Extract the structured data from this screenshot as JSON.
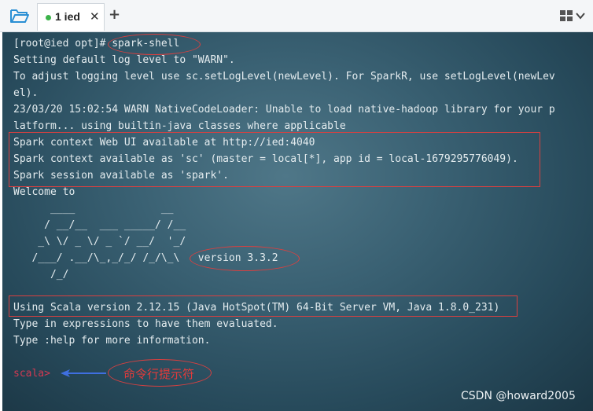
{
  "tabbar": {
    "folder_icon": "folder-open-icon",
    "tab_label": "1 ied",
    "tab_close": "✕",
    "new_tab": "+",
    "layout_icon": "grid-icon",
    "menu_icon": "chevron-down-icon"
  },
  "terminal": {
    "lines": [
      "[root@ied opt]# spark-shell",
      "Setting default log level to \"WARN\".",
      "To adjust logging level use sc.setLogLevel(newLevel). For SparkR, use setLogLevel(newLev",
      "el).",
      "23/03/20 15:02:54 WARN NativeCodeLoader: Unable to load native-hadoop library for your p",
      "latform... using builtin-java classes where applicable",
      "Spark context Web UI available at http://ied:4040",
      "Spark context available as 'sc' (master = local[*], app id = local-1679295776049).",
      "Spark session available as 'spark'.",
      "Welcome to"
    ],
    "logo": [
      "      ____              __",
      "     / __/__  ___ _____/ /__",
      "    _\\ \\/ _ \\/ _ `/ __/  '_/",
      "   /___/ .__/\\_,_/_/ /_/\\_\\   version 3.3.2",
      "      /_/"
    ],
    "after": [
      "Using Scala version 2.12.15 (Java HotSpot(TM) 64-Bit Server VM, Java 1.8.0_231)",
      "Type in expressions to have them evaluated.",
      "Type :help for more information."
    ],
    "prompt": "scala>"
  },
  "annotation": {
    "label": "命令行提示符",
    "color": "#e23b3b"
  },
  "watermark": "CSDN @howard2005"
}
